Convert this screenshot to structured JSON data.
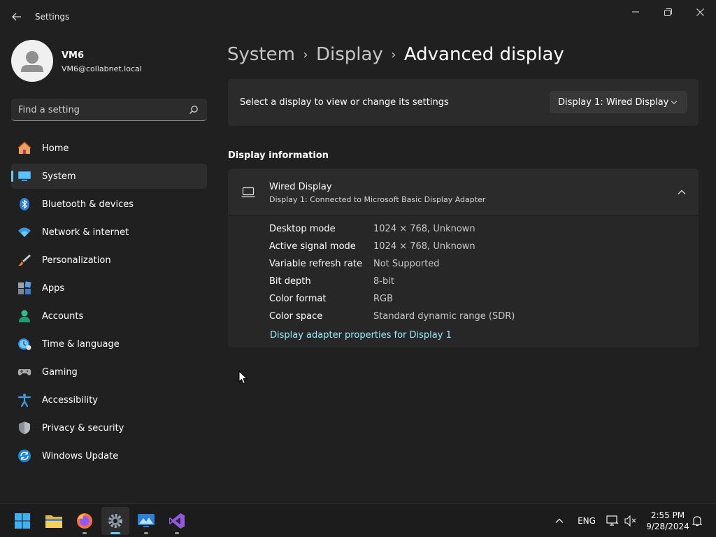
{
  "window": {
    "title": "Settings"
  },
  "profile": {
    "name": "VM6",
    "email": "VM6@collabnet.local"
  },
  "search": {
    "placeholder": "Find a setting"
  },
  "sidebar": {
    "items": [
      {
        "label": "Home",
        "icon": "home-icon"
      },
      {
        "label": "System",
        "icon": "system-icon",
        "active": true
      },
      {
        "label": "Bluetooth & devices",
        "icon": "bluetooth-icon"
      },
      {
        "label": "Network & internet",
        "icon": "network-icon"
      },
      {
        "label": "Personalization",
        "icon": "personalization-icon"
      },
      {
        "label": "Apps",
        "icon": "apps-icon"
      },
      {
        "label": "Accounts",
        "icon": "accounts-icon"
      },
      {
        "label": "Time & language",
        "icon": "time-language-icon"
      },
      {
        "label": "Gaming",
        "icon": "gaming-icon"
      },
      {
        "label": "Accessibility",
        "icon": "accessibility-icon"
      },
      {
        "label": "Privacy & security",
        "icon": "privacy-shield-icon"
      },
      {
        "label": "Windows Update",
        "icon": "windows-update-icon"
      }
    ]
  },
  "breadcrumb": {
    "items": [
      "System",
      "Display",
      "Advanced display"
    ]
  },
  "display_select": {
    "label": "Select a display to view or change its settings",
    "selected": "Display 1: Wired Display"
  },
  "display_info": {
    "section_title": "Display information",
    "display_name": "Wired Display",
    "display_subtitle": "Display 1: Connected to Microsoft Basic Display Adapter",
    "rows": [
      {
        "key": "Desktop mode",
        "value": "1024 × 768, Unknown"
      },
      {
        "key": "Active signal mode",
        "value": "1024 × 768, Unknown"
      },
      {
        "key": "Variable refresh rate",
        "value": "Not Supported"
      },
      {
        "key": "Bit depth",
        "value": "8-bit"
      },
      {
        "key": "Color format",
        "value": "RGB"
      },
      {
        "key": "Color space",
        "value": "Standard dynamic range (SDR)"
      }
    ],
    "adapter_link": "Display adapter properties for Display 1"
  },
  "taskbar": {
    "apps": [
      "start-icon",
      "file-explorer-icon",
      "firefox-icon",
      "settings-gear-icon",
      "remote-desktop-icon",
      "visual-studio-icon"
    ],
    "language": "ENG",
    "time": "2:55 PM",
    "date": "9/28/2024"
  },
  "colors": {
    "accent": "#60cdff",
    "link": "#99ebff",
    "background": "#202020",
    "card": "#2b2b2b"
  }
}
